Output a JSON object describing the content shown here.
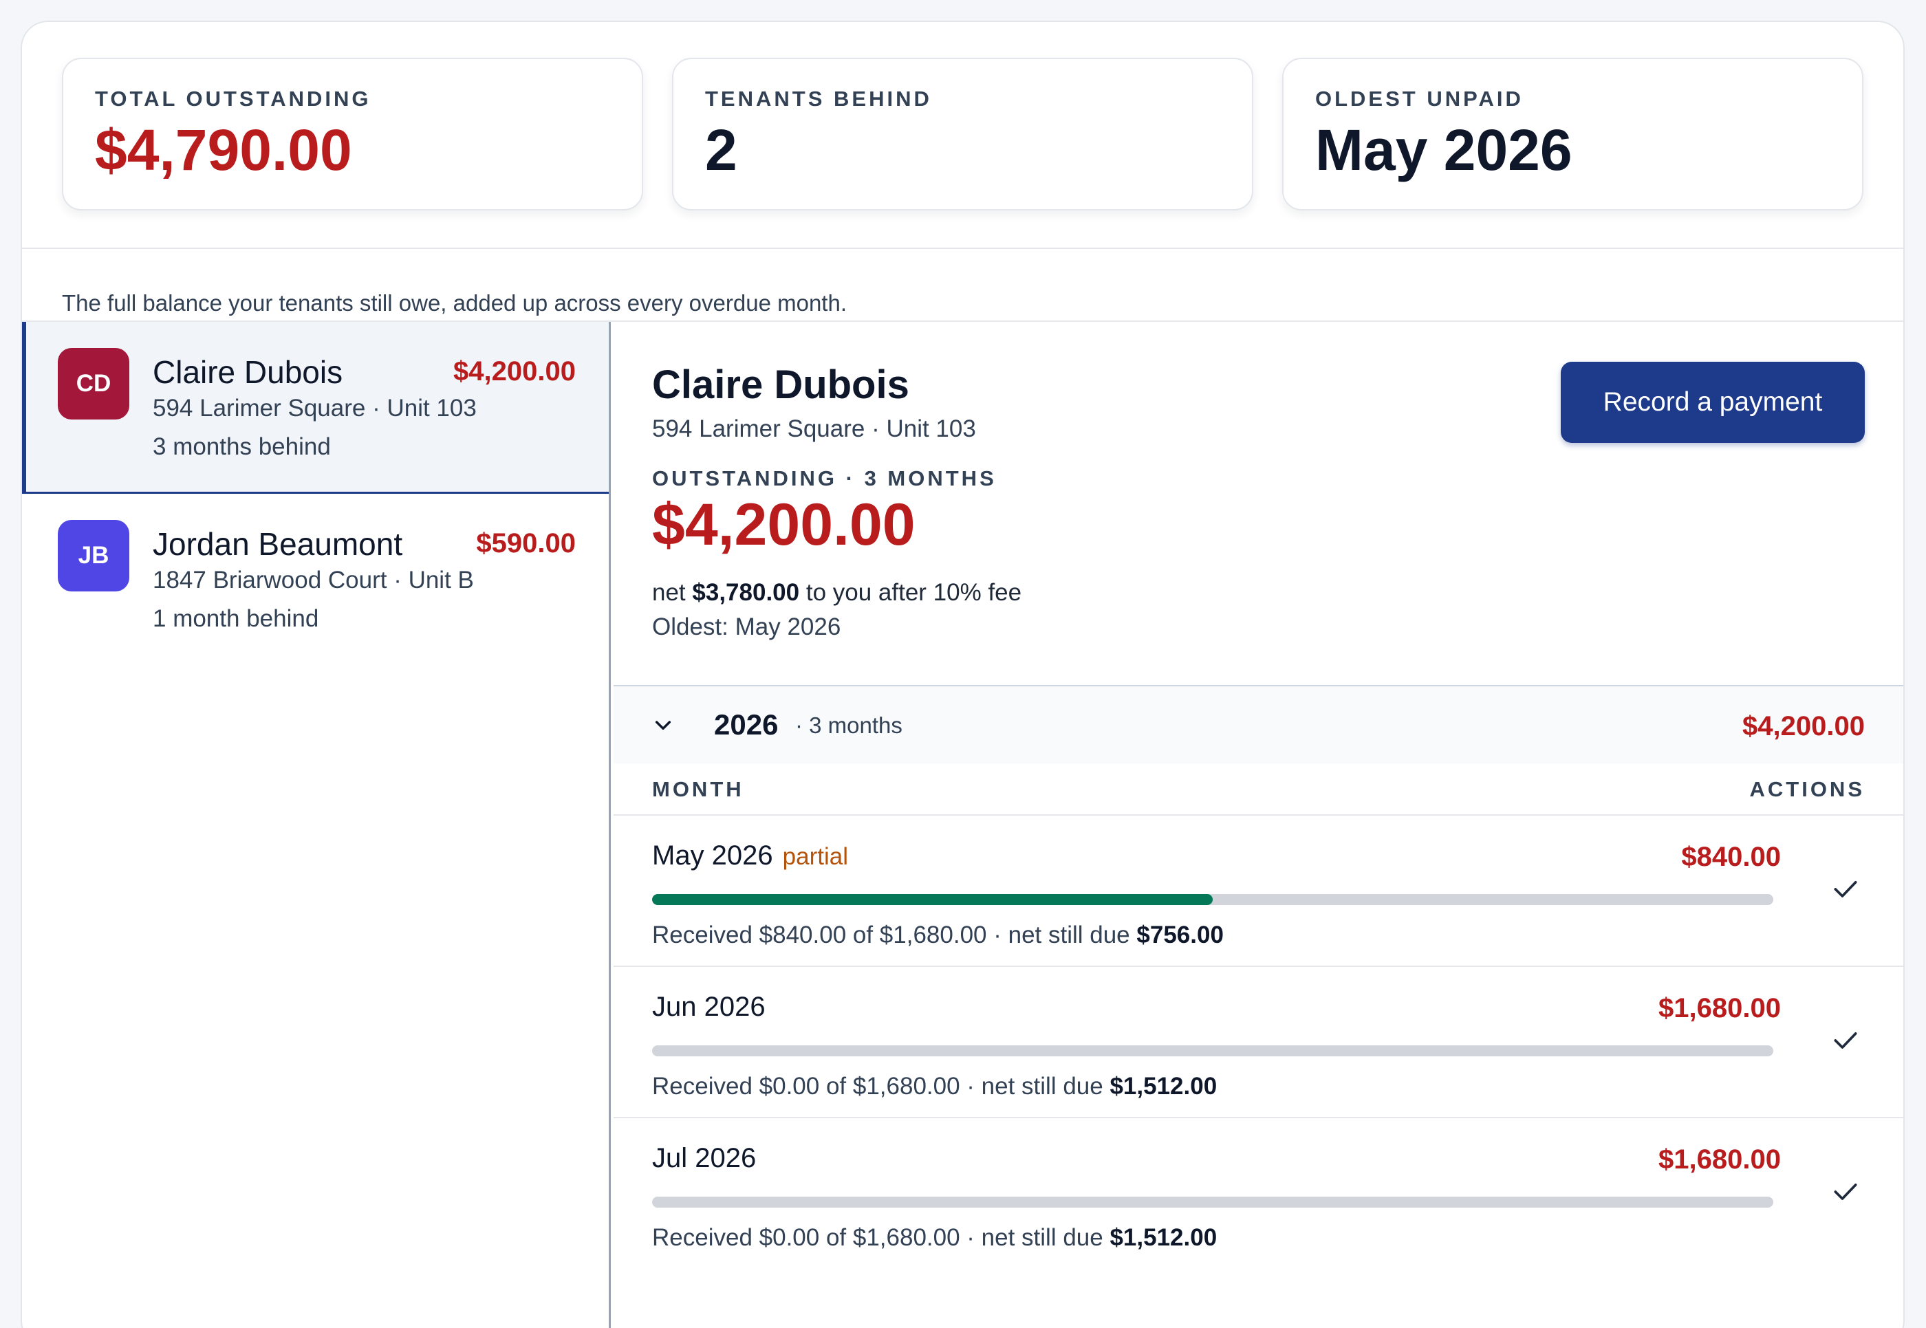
{
  "stats": [
    {
      "label": "TOTAL OUTSTANDING",
      "value": "$4,790.00",
      "accent": "#b91c1c"
    },
    {
      "label": "TENANTS BEHIND",
      "value": "2"
    },
    {
      "label": "OLDEST UNPAID",
      "value": "May 2026"
    }
  ],
  "subtitle": "The full balance your tenants still owe, added up across every overdue month.",
  "tenants": [
    {
      "initials": "CD",
      "name": "Claire Dubois",
      "amount": "$4,200.00",
      "address": "594 Larimer Square · Unit 103",
      "behind": "3 months behind",
      "avatar_color": "#a3173a",
      "selected": true
    },
    {
      "initials": "JB",
      "name": "Jordan Beaumont",
      "amount": "$590.00",
      "address": "1847 Briarwood Court · Unit B",
      "behind": "1 month behind",
      "avatar_color": "#4f46e5",
      "selected": false
    }
  ],
  "detail": {
    "name": "Claire Dubois",
    "address": "594 Larimer Square · Unit 103",
    "outstanding_label": "OUTSTANDING · 3 MONTHS",
    "amount": "$4,200.00",
    "net_prefix": "net",
    "net_amount": "$3,780.00",
    "net_suffix": "to you after 10% fee",
    "oldest": "Oldest: May 2026",
    "record_button": "Record a payment"
  },
  "year_group": {
    "year": "2026",
    "sub": "· 3 months",
    "amount": "$4,200.00",
    "col_month": "MONTH",
    "col_actions": "ACTIONS"
  },
  "months": [
    {
      "name": "May 2026",
      "badge": "partial",
      "amount": "$840.00",
      "progress": 0.5,
      "received": "Received $840.00 of $1,680.00 · net still due",
      "net_due": "$756.00"
    },
    {
      "name": "Jun 2026",
      "badge": "",
      "amount": "$1,680.00",
      "progress": 0,
      "received": "Received $0.00 of $1,680.00 · net still due",
      "net_due": "$1,512.00"
    },
    {
      "name": "Jul 2026",
      "badge": "",
      "amount": "$1,680.00",
      "progress": 0,
      "received": "Received $0.00 of $1,680.00 · net still due",
      "net_due": "$1,512.00"
    }
  ],
  "colors": {
    "primary": "#1e3a8a",
    "danger": "#b91c1c",
    "progress": "#047857",
    "warning": "#b45309"
  }
}
